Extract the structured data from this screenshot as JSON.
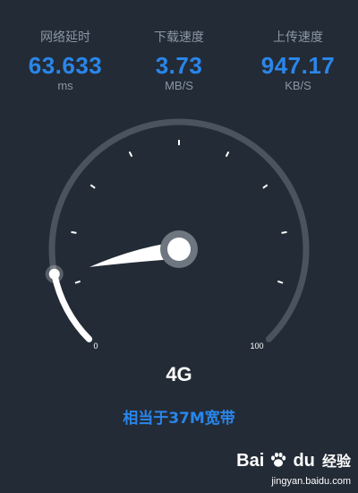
{
  "stats": {
    "latency": {
      "label": "网络延时",
      "value": "63.633",
      "unit": "ms"
    },
    "download": {
      "label": "下载速度",
      "value": "3.73",
      "unit": "MB/S"
    },
    "upload": {
      "label": "上传速度",
      "value": "947.17",
      "unit": "KB/S"
    }
  },
  "gauge": {
    "min_label": "0",
    "max_label": "100",
    "level_fraction": 0.125
  },
  "network_type": "4G",
  "bandwidth_text": "相当于37M宽带",
  "watermark": {
    "bai": "Bai",
    "du": "du",
    "jingyan": "经验",
    "url": "jingyan.baidu.com"
  },
  "colors": {
    "background": "#232b36",
    "accent_blue": "#2a86ea",
    "label_gray": "#8a96a6",
    "gauge_track": "#4a535e",
    "gauge_fill": "#ffffff"
  }
}
